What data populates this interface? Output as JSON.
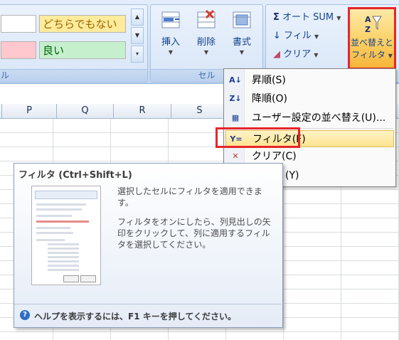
{
  "styles": {
    "neutral": "どちらでもない",
    "good": "良い",
    "left_label_fragment": "ル"
  },
  "cells_group": {
    "label": "セル",
    "insert": "挿入",
    "delete": "削除",
    "format": "書式"
  },
  "editing": {
    "autosum": "オート SUM",
    "fill": "フィル",
    "clear": "クリア",
    "sort_filter_line1": "並べ替えと",
    "sort_filter_line2": "フィルタ"
  },
  "columns": [
    "P",
    "Q",
    "R",
    "S"
  ],
  "menu": {
    "items": [
      {
        "label": "昇順(S)",
        "icon": "sort-asc-icon"
      },
      {
        "label": "降順(O)",
        "icon": "sort-desc-icon"
      },
      {
        "label": "ユーザー設定の並べ替え(U)...",
        "icon": "custom-sort-icon"
      },
      {
        "label": "フィルタ(F)",
        "icon": "filter-icon"
      },
      {
        "label": "クリア(C)",
        "icon": "clear-filter-icon"
      },
      {
        "label": "(Y)",
        "icon": "reapply-icon"
      }
    ]
  },
  "tooltip": {
    "title": "フィルタ (Ctrl+Shift+L)",
    "para1": "選択したセルにフィルタを適用できます。",
    "para2": "フィルタをオンにしたら、列見出しの矢印をクリックして、列に適用するフィルタを選択してください。",
    "footer": "ヘルプを表示するには、F1 キーを押してください。"
  },
  "colors": {
    "highlight_red": "#e6262b",
    "neutral_bg": "#ffeb9c",
    "good_bg": "#c6efce",
    "bad_bg": "#ffc7ce"
  }
}
